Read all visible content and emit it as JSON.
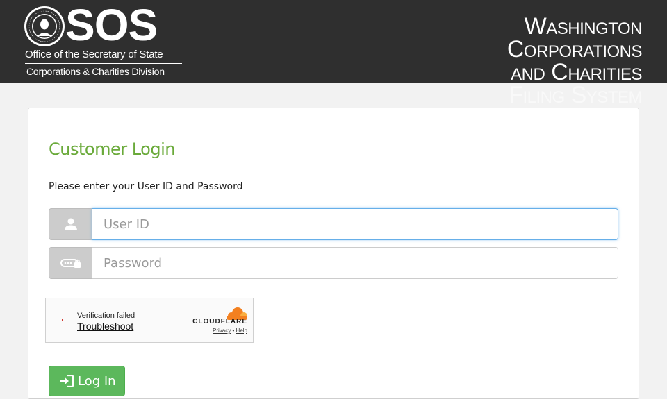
{
  "header": {
    "logo_text": "SOS",
    "office_line": "Office of the Secretary of State",
    "division_line": "Corporations & Charities Division",
    "seal_icon": "state-seal-icon",
    "system_title": [
      "Washington",
      "Corporations",
      "and Charities",
      "Filing System"
    ]
  },
  "login": {
    "title": "Customer Login",
    "instruction": "Please enter your User ID and Password",
    "userid_placeholder": "User ID",
    "userid_value": "",
    "password_placeholder": "Password",
    "password_value": "",
    "user_icon": "user-icon",
    "password_icon": "password-key-icon",
    "button_label": "Log In",
    "button_icon": "sign-in-icon"
  },
  "captcha": {
    "status": "Verification failed",
    "troubleshoot": "Troubleshoot",
    "brand": "CLOUDFLARE",
    "privacy": "Privacy",
    "separator": "•",
    "help": "Help"
  },
  "colors": {
    "header_bg": "#2f2f2f",
    "title_green": "#6aaa3a",
    "button_green": "#5cb85c",
    "focus_blue": "#66afe9",
    "cloudflare_orange": "#f38020"
  }
}
